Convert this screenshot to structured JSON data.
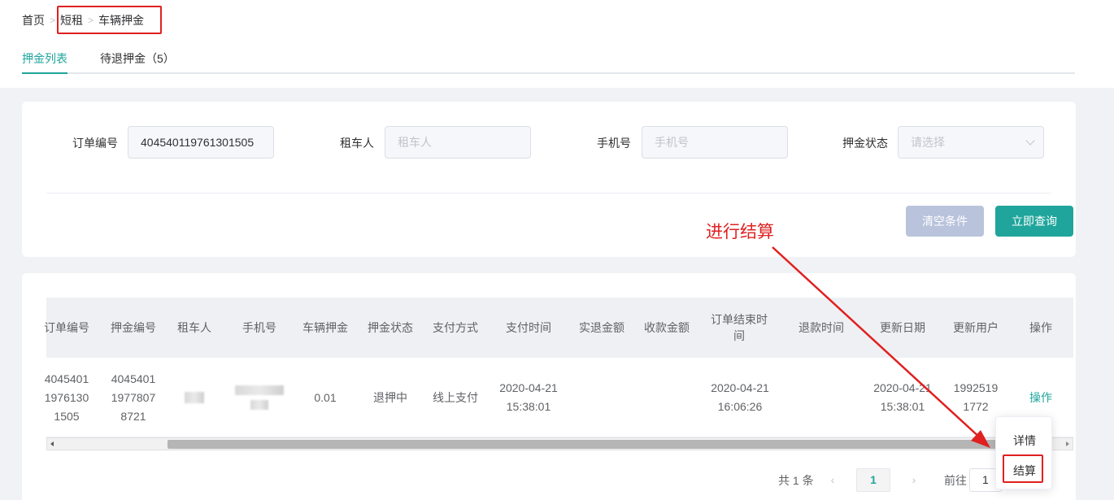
{
  "breadcrumb": {
    "home": "首页",
    "level1": "短租",
    "level2": "车辆押金"
  },
  "tabs": [
    {
      "label": "押金列表"
    },
    {
      "label": "待退押金（5）"
    }
  ],
  "search": {
    "order_no_label": "订单编号",
    "order_no_value": "404540119761301505",
    "renter_label": "租车人",
    "renter_placeholder": "租车人",
    "phone_label": "手机号",
    "phone_placeholder": "手机号",
    "status_label": "押金状态",
    "status_placeholder": "请选择",
    "clear_label": "清空条件",
    "query_label": "立即查询"
  },
  "annotation": {
    "text": "进行结算",
    "color": "#e02020"
  },
  "table": {
    "headers": [
      "订单编号",
      "押金编号",
      "租车人",
      "手机号",
      "车辆押金",
      "押金状态",
      "支付方式",
      "支付时间",
      "实退金额",
      "收款金额",
      "订单结束时间",
      "退款时间",
      "更新日期",
      "更新用户",
      "操作"
    ],
    "row": {
      "order_no": "4045401\n1976130\n1505",
      "deposit_no": "4045401\n1977807\n8721",
      "deposit_amount": "0.01",
      "deposit_status": "退押中",
      "pay_method": "线上支付",
      "pay_time": "2020-04-21\n15:38:01",
      "refund_amount": "",
      "collect_amount": "",
      "order_end_time": "2020-04-21\n16:06:26",
      "refund_time": "",
      "update_date": "2020-04-21\n15:38:01",
      "update_user": "1992519\n1772",
      "action": "操作"
    }
  },
  "dropdown": {
    "detail": "详情",
    "settle": "结算"
  },
  "pagination": {
    "total": "共 1 条",
    "prev": "‹",
    "page": "1",
    "next": "›",
    "goto": "前往",
    "goto_value": "1"
  },
  "colors": {
    "accent": "#1fa59b",
    "highlight": "#e02020",
    "clear_button": "#b9c3db"
  }
}
